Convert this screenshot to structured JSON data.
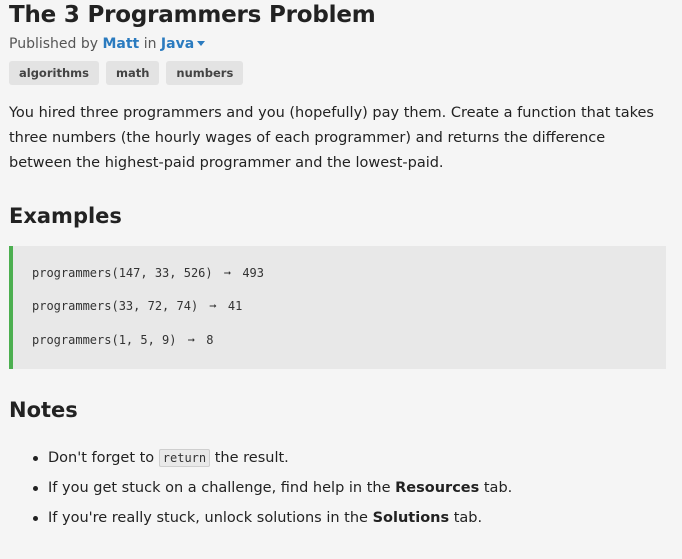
{
  "challenge": {
    "title": "The 3 Programmers Problem",
    "published_by_prefix": "Published by",
    "author": "Matt",
    "in_word": "in",
    "language": "Java",
    "tags": [
      "algorithms",
      "math",
      "numbers"
    ],
    "description": "You hired three programmers and you (hopefully) pay them. Create a function that takes three numbers (the hourly wages of each programmer) and returns the difference between the highest-paid programmer and the lowest-paid."
  },
  "examples": {
    "heading": "Examples",
    "arrow": "➞",
    "items": [
      {
        "call": "programmers(147, 33, 526)",
        "result": "493"
      },
      {
        "call": "programmers(33, 72, 74)",
        "result": "41"
      },
      {
        "call": "programmers(1, 5, 9)",
        "result": "8"
      }
    ]
  },
  "notes": {
    "heading": "Notes",
    "items": [
      {
        "pre": "Don't forget to ",
        "code": "return",
        "post": " the result."
      },
      {
        "pre": "If you get stuck on a challenge, find help in the ",
        "bold": "Resources",
        "post": " tab."
      },
      {
        "pre": "If you're really stuck, unlock solutions in the ",
        "bold": "Solutions",
        "post": " tab."
      }
    ]
  },
  "colors": {
    "link": "#2b7bbf",
    "example_border": "#4caf50",
    "example_bg": "#e8e8e8",
    "page_bg": "#f5f5f5"
  }
}
